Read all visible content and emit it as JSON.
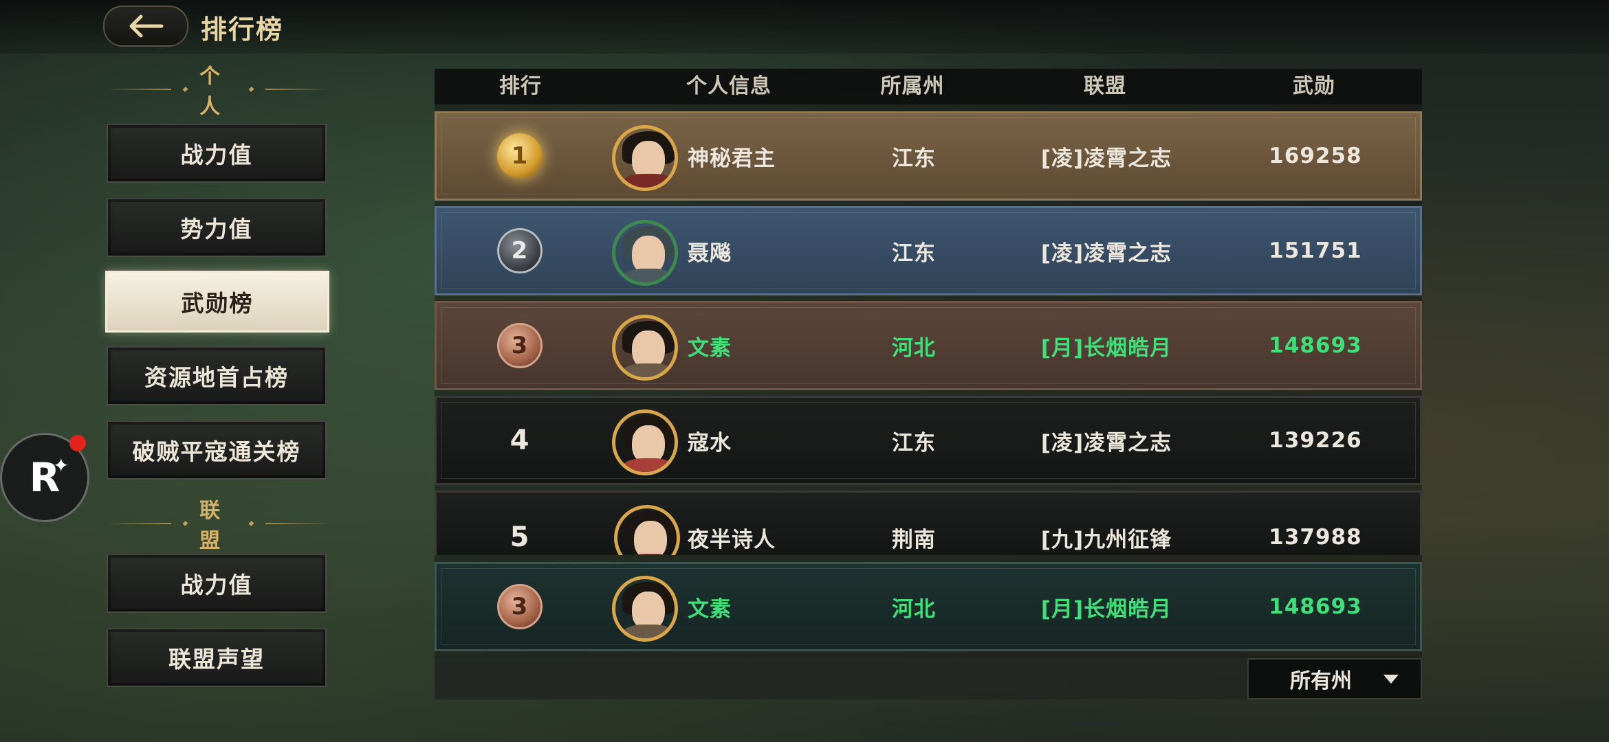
{
  "header": {
    "title": "排行榜"
  },
  "sidebar": {
    "personal_heading": "个人",
    "personal_items": [
      {
        "label": "战力值",
        "active": false
      },
      {
        "label": "势力值",
        "active": false
      },
      {
        "label": "武勋榜",
        "active": true
      },
      {
        "label": "资源地首占榜",
        "active": false
      },
      {
        "label": "破贼平寇通关榜",
        "active": false
      }
    ],
    "alliance_heading": "联盟",
    "alliance_items": [
      {
        "label": "战力值"
      },
      {
        "label": "联盟声望"
      }
    ]
  },
  "floating_button": {
    "icon": "R",
    "has_notification": true
  },
  "table": {
    "headers": {
      "rank": "排行",
      "info": "个人信息",
      "state": "所属州",
      "alliance": "联盟",
      "merit": "武勋"
    },
    "rows": [
      {
        "rank": "1",
        "name": "神秘君主",
        "state": "江东",
        "alliance": "[凌]凌霄之志",
        "merit": "169258"
      },
      {
        "rank": "2",
        "name": "聂飚",
        "state": "江东",
        "alliance": "[凌]凌霄之志",
        "merit": "151751"
      },
      {
        "rank": "3",
        "name": "文素",
        "state": "河北",
        "alliance": "[月]长烟皓月",
        "merit": "148693"
      },
      {
        "rank": "4",
        "name": "寇水",
        "state": "江东",
        "alliance": "[凌]凌霄之志",
        "merit": "139226"
      },
      {
        "rank": "5",
        "name": "夜半诗人",
        "state": "荆南",
        "alliance": "[九]九州征锋",
        "merit": "137988"
      }
    ],
    "self_row": {
      "rank": "3",
      "name": "文素",
      "state": "河北",
      "alliance": "[月]长烟皓月",
      "merit": "148693"
    }
  },
  "filter": {
    "selected": "所有州"
  },
  "colors": {
    "highlight_green": "#3fe07a",
    "gold_title": "#e9d6a6",
    "active_tab_bg": "#f6f1e3"
  }
}
